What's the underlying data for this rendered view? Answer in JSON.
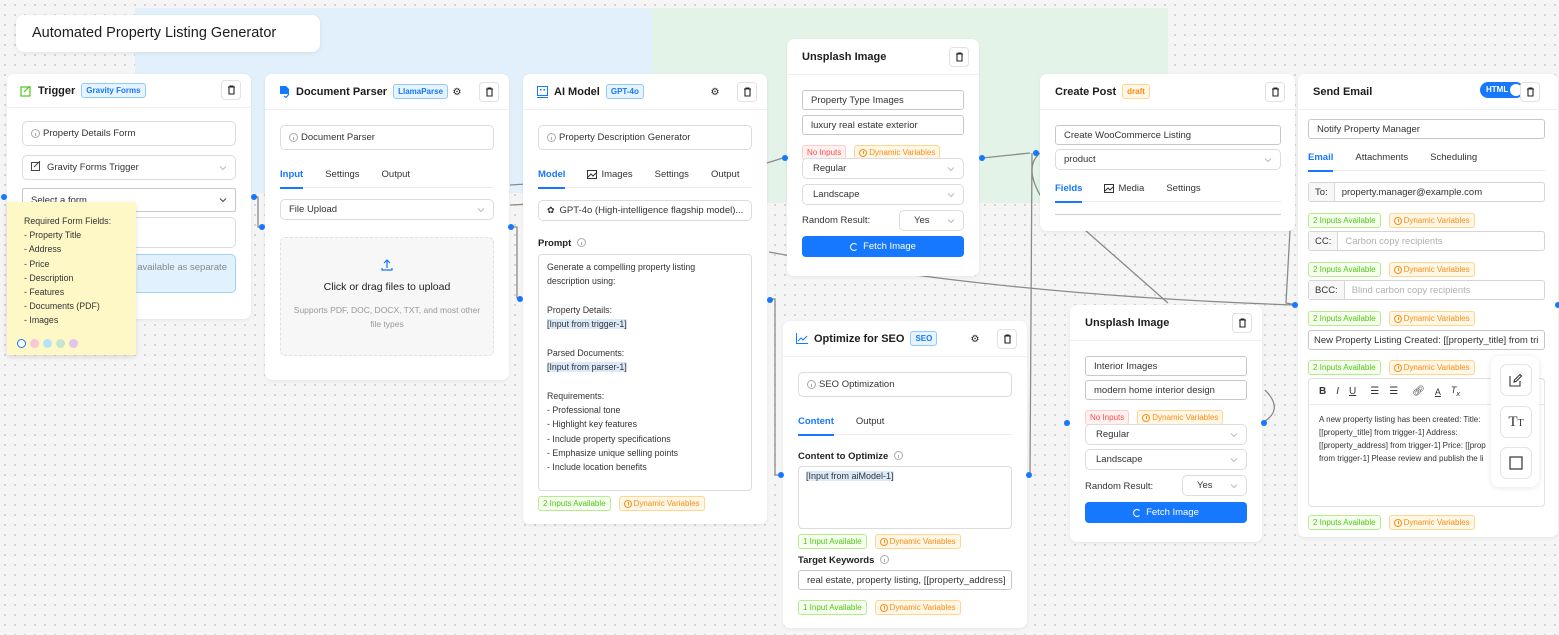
{
  "canvas": {
    "title": "Automated Property Listing Generator"
  },
  "trigger": {
    "title": "Trigger",
    "badge": "Gravity Forms",
    "name_field": "Property Details Form",
    "type_select": "Gravity Forms Trigger",
    "form_select_placeholder": "Select a form",
    "info_text": "available as separate"
  },
  "sticky_note": {
    "heading": "Required Form Fields:",
    "items": [
      "- Property Title",
      "- Address",
      "- Price",
      "- Description",
      "- Features",
      "- Documents (PDF)",
      "- Images"
    ],
    "swatch_colors": [
      "#ffffff",
      "#f9c6d8",
      "#b3e3f9",
      "#c8e6cf",
      "#e1c4ec"
    ]
  },
  "parser": {
    "title": "Document Parser",
    "badge": "LlamaParse",
    "name_field": "Document Parser",
    "tabs": [
      "Input",
      "Settings",
      "Output"
    ],
    "source_select": "File Upload",
    "upload_title": "Click or drag files to upload",
    "upload_hint": "Supports PDF, DOC, DOCX, TXT, and most other file types"
  },
  "ai_model": {
    "title": "AI Model",
    "badge": "GPT-4o",
    "name_field": "Property Description Generator",
    "tabs": [
      "Model",
      "Images",
      "Settings",
      "Output"
    ],
    "model_select": "GPT-4o (High-intelligence flagship model)...",
    "prompt_label": "Prompt",
    "prompt_lines": [
      "Generate a compelling property listing",
      "description using:",
      "",
      "Property Details:",
      "[Input from trigger-1]",
      "",
      "Parsed Documents:",
      "[Input from parser-1]",
      "",
      "Requirements:",
      "- Professional tone",
      "- Highlight key features",
      "- Include property specifications",
      "- Emphasize unique selling points",
      "- Include location benefits"
    ],
    "inputs_pill": "2 Inputs Available",
    "vars_pill": "Dynamic Variables"
  },
  "unsplash1": {
    "title": "Unsplash Image",
    "name_field": "Property Type Images",
    "query_field": "luxury real estate exterior",
    "inputs_pill": "No Inputs",
    "vars_pill": "Dynamic Variables",
    "type_select": "Regular",
    "orientation_select": "Landscape",
    "random_label": "Random Result:",
    "random_select": "Yes",
    "fetch_button": "Fetch Image"
  },
  "seo": {
    "title": "Optimize for SEO",
    "badge": "SEO",
    "name_field": "SEO Optimization",
    "tabs": [
      "Content",
      "Output"
    ],
    "content_label": "Content to Optimize",
    "content_value": "[Input from aiModel-1]",
    "content_inputs_pill": "1 Input Available",
    "content_vars_pill": "Dynamic Variables",
    "keywords_label": "Target Keywords",
    "keywords_value": "real estate, property listing, [[property_address]",
    "keywords_inputs_pill": "1 Input Available",
    "keywords_vars_pill": "Dynamic Variables"
  },
  "create_post": {
    "title": "Create Post",
    "badge": "draft",
    "name_field": "Create WooCommerce Listing",
    "post_type_select": "product",
    "tabs": [
      "Fields",
      "Media",
      "Settings"
    ]
  },
  "unsplash2": {
    "title": "Unsplash Image",
    "name_field": "Interior Images",
    "query_field": "modern home interior design",
    "inputs_pill": "No Inputs",
    "vars_pill": "Dynamic Variables",
    "type_select": "Regular",
    "orientation_select": "Landscape",
    "random_label": "Random Result:",
    "random_select": "Yes",
    "fetch_button": "Fetch Image"
  },
  "send_email": {
    "title": "Send Email",
    "html_toggle": "HTML",
    "html_toggle_on": true,
    "name_field": "Notify Property Manager",
    "tabs": [
      "Email",
      "Attachments",
      "Scheduling"
    ],
    "to_label": "To:",
    "to_value": "property.manager@example.com",
    "cc_label": "CC:",
    "cc_placeholder": "Carbon copy recipients",
    "bcc_label": "BCC:",
    "bcc_placeholder": "Blind carbon copy recipients",
    "subject_value": "New Property Listing Created: [[property_title] from tri",
    "inputs_pill": "2 Inputs Available",
    "vars_pill": "Dynamic Variables",
    "toolbar": [
      "B",
      "I",
      "U",
      "ordered-list",
      "bullet-list",
      "link",
      "text-color",
      "clear-format"
    ],
    "body_lines": [
      "A new property listing has been created: Title:",
      "[[property_title] from trigger-1] Address:",
      "[[property_address] from trigger-1] Price: [[prop",
      "from trigger-1] Please review and publish the li"
    ]
  },
  "floating_tools": [
    "edit-note-tool",
    "text-tool",
    "rectangle-tool"
  ]
}
